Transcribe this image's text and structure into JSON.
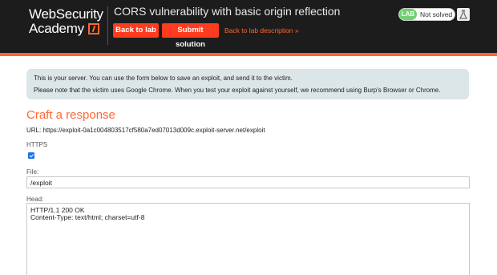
{
  "header": {
    "logo_line1": "WebSecurity",
    "logo_line2": "Academy",
    "lab_title": "CORS vulnerability with basic origin reflection",
    "back_label": "Back to lab",
    "submit_label": "Submit solution",
    "desc_link": "Back to lab description  »",
    "status_badge": "LAB",
    "status_text": "Not solved",
    "accent_color": "#ff6633",
    "button_color": "#ff3b1f",
    "badge_color": "#70d16d",
    "beaker_icon": "beaker-icon"
  },
  "notice": {
    "line1": "This is your server. You can use the form below to save an exploit, and send it to the victim.",
    "line2": "Please note that the victim uses Google Chrome. When you test your exploit against yourself, we recommend using Burp's Browser or Chrome."
  },
  "form": {
    "title": "Craft a response",
    "url": "URL: https://exploit-0a1c004803517cf580a7ed07013d009c.exploit-server.net/exploit",
    "https_label": "HTTPS",
    "https_checked": true,
    "file_label": "File:",
    "file_value": "/exploit",
    "head_label": "Head:",
    "head_line1": "HTTP/1.1 200 OK",
    "head_line2": "Content-Type: text/html; charset=utf-8"
  }
}
